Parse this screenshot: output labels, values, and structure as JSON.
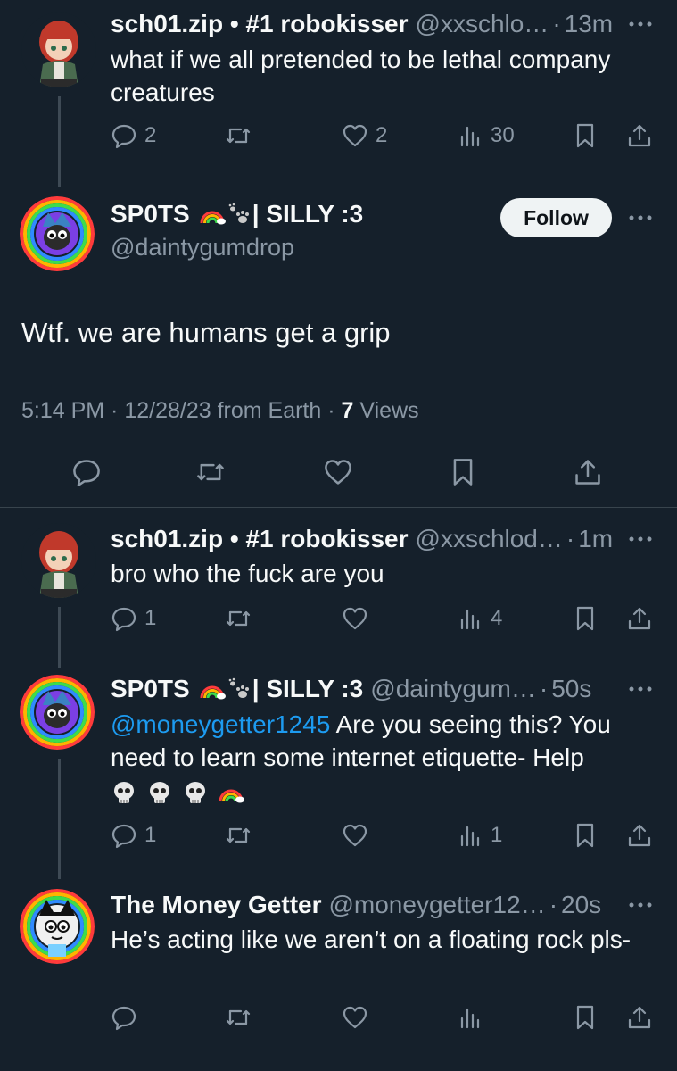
{
  "post1": {
    "name": "sch01.zip • #1 robokisser",
    "handle": "@xxschlo…",
    "time": "13m",
    "text": "what if we all pretended to be lethal company creatures",
    "replies": "2",
    "likes": "2",
    "views": "30"
  },
  "main": {
    "name": "SP0TS",
    "name_suffix": "| SILLY :3",
    "handle": "@daintygumdrop",
    "follow_label": "Follow",
    "text": "Wtf. we are humans get a grip",
    "timestamp": "5:14 PM · 12/28/23 from Earth · ",
    "views_count": "7",
    "views_label": " Views"
  },
  "reply1": {
    "name": "sch01.zip • #1 robokisser",
    "handle": "@xxschlod…",
    "time": "1m",
    "text": "bro who the fuck are you",
    "replies": "1",
    "views": "4"
  },
  "reply2": {
    "name": "SP0TS",
    "name_suffix": "| SILLY :3",
    "handle": "@daintygum…",
    "time": "50s",
    "mention": "@moneygetter1245",
    "text": " Are you seeing this? You need to learn some internet etiquette- Help",
    "replies": "1",
    "views": "1"
  },
  "reply3": {
    "name": "The Money Getter",
    "handle": "@moneygetter12…",
    "time": "20s",
    "text": "He’s acting like we aren’t on a floating rock pls-"
  },
  "icons": {
    "reply": "reply-icon",
    "retweet": "retweet-icon",
    "like": "heart-icon",
    "views": "views-icon",
    "bookmark": "bookmark-icon",
    "share": "share-icon"
  },
  "colors": {
    "background": "#15202b",
    "text": "#f7f9f9",
    "muted": "#8b98a5",
    "link": "#1d9bf0"
  }
}
